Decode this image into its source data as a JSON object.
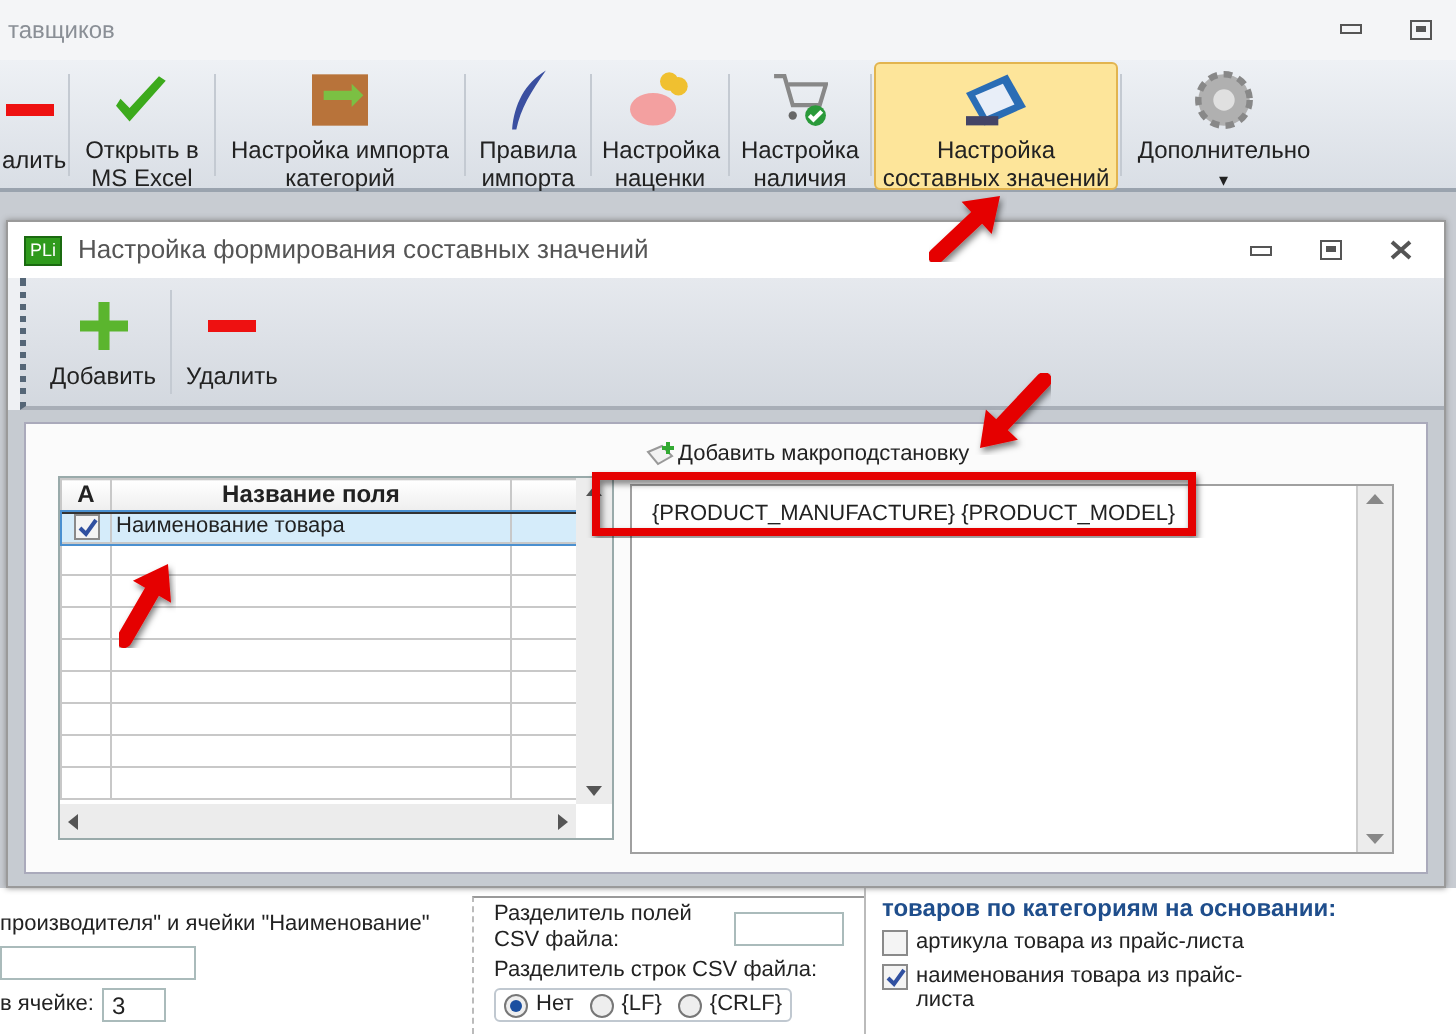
{
  "app": {
    "title": "тавщиков",
    "ribbon": [
      {
        "label": "алить",
        "selected": false
      },
      {
        "label": "Открыть в MS Excel",
        "selected": false
      },
      {
        "label": "Настройка импорта категорий",
        "selected": false
      },
      {
        "label": "Правила импорта",
        "selected": false
      },
      {
        "label": "Настройка наценки",
        "selected": false
      },
      {
        "label": "Настройка наличия",
        "selected": false
      },
      {
        "label": "Настройка составных значений",
        "selected": true
      },
      {
        "label": "Дополнительно",
        "selected": false,
        "caret": "▾"
      }
    ]
  },
  "dialog": {
    "logo": "PLi",
    "title": "Настройка формирования составных значений",
    "toolbar": [
      {
        "label": "Добавить"
      },
      {
        "label": "Удалить"
      }
    ],
    "grid": {
      "columns": [
        "A",
        "Название поля"
      ],
      "rows": [
        {
          "checked": true,
          "selected": true,
          "name": "Наименование товара"
        }
      ]
    },
    "macro_link": "Добавить макроподстановку",
    "template": "{PRODUCT_MANUFACTURE} {PRODUCT_MODEL}"
  },
  "form": {
    "left": [
      {
        "kind": "text",
        "text": "производителя\" и ячейки \"Наименование\""
      },
      {
        "kind": "input"
      },
      {
        "kind": "labeled",
        "text": "в ячейке:",
        "value": "3"
      }
    ],
    "csv": {
      "field_sep_label": "Разделитель полей CSV файла:",
      "line_sep_label": "Разделитель строк CSV файла:",
      "line_options": [
        {
          "label": "Нет",
          "selected": true
        },
        {
          "label": "{LF}",
          "selected": false
        },
        {
          "label": "{CRLF}",
          "selected": false
        }
      ]
    },
    "auto": {
      "heading": "товаров по категориям на основании:",
      "options": [
        {
          "label": "артикула товара из прайс-листа",
          "checked": false
        },
        {
          "label": "наименования товара из прайс-листа",
          "checked": true
        }
      ]
    }
  },
  "annotations": [
    {
      "kind": "arrow"
    },
    {
      "kind": "arrow"
    },
    {
      "kind": "arrow"
    },
    {
      "kind": "frame"
    }
  ]
}
